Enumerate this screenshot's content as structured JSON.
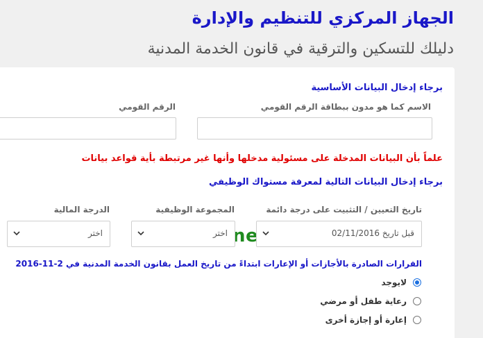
{
  "header": {
    "org_title": "الجهاز المركزي للتنظيم والإدارة",
    "subtitle": "دليلك للتسكين والترقية في قانون الخدمة المدنية"
  },
  "basic_info": {
    "heading": "برجاء إدخال البيانات الأساسية",
    "name_label": "الاسم كما هو مدون ببطاقة الرقم القومي",
    "name_value": "",
    "national_id_label": "الرقم القومي",
    "national_id_value": ""
  },
  "warning_text": "علماً بأن البيانات المدخلة على مسئولية مدخلها وأنها غير مرتبطة بأية قواعد بيانات",
  "watermark": "alsaudinews.com",
  "career_info": {
    "heading": "برجاء إدخال البيانات التالية لمعرفة مستواك الوظيفي",
    "appointment_label": "تاريخ التعيين / التثبيت على درجة دائمة",
    "appointment_value": "قبل تاريخ 02/11/2016",
    "job_group_label": "المجموعة الوظيفية",
    "job_group_value": "اختر",
    "financial_grade_label": "الدرجة المالية",
    "financial_grade_value": "اختر"
  },
  "decisions": {
    "title": "القرارات الصادرة بالأجازات أو الإعارات ابتداءً من تاريخ العمل بقانون الخدمة المدنية في 2-11-2016",
    "options": [
      {
        "label": "لايوجد",
        "checked": true
      },
      {
        "label": "رعاية طفل أو مرضي",
        "checked": false
      },
      {
        "label": "إعارة أو إجازة أخرى",
        "checked": false
      }
    ]
  },
  "icons": {
    "select_arrow": "chevron-down-icon"
  }
}
